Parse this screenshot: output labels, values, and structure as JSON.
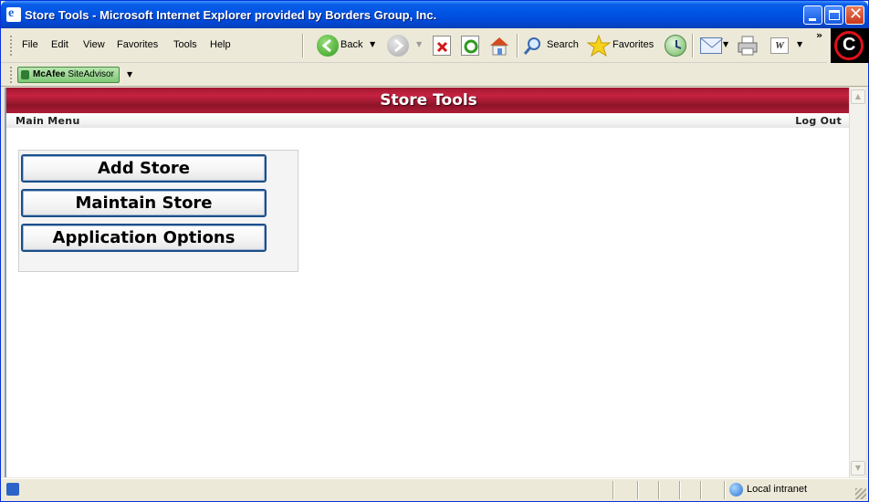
{
  "window": {
    "title": "Store Tools - Microsoft Internet Explorer provided by Borders Group, Inc."
  },
  "menu": {
    "items": [
      "File",
      "Edit",
      "View",
      "Favorites",
      "Tools",
      "Help"
    ]
  },
  "toolbar": {
    "back_label": "Back",
    "search_label": "Search",
    "favorites_label": "Favorites",
    "more_glyph": "»"
  },
  "links_bar": {
    "mcafee_brand": "McAfee",
    "mcafee_product": "SiteAdvisor"
  },
  "page": {
    "banner_title": "Store Tools",
    "nav_main_menu": "Main Menu",
    "nav_log_out": "Log Out",
    "buttons": [
      "Add Store",
      "Maintain Store",
      "Application Options"
    ]
  },
  "status": {
    "zone": "Local intranet"
  },
  "colors": {
    "banner": "#a01830",
    "button_border": "#1d4f8a",
    "titlebar": "#0055e5"
  },
  "icons": [
    "ie-page-icon",
    "back-icon",
    "forward-icon",
    "stop-icon",
    "refresh-icon",
    "home-icon",
    "search-icon",
    "favorites-star-icon",
    "history-icon",
    "mail-icon",
    "print-icon",
    "word-icon",
    "brand-c-icon",
    "globe-icon"
  ]
}
